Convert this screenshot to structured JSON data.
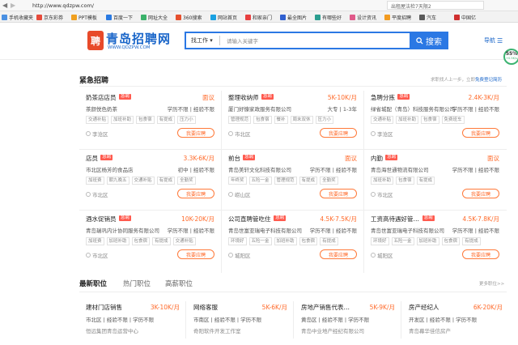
{
  "browser": {
    "url": "http://www.qdzpw.com/",
    "right_search": "出租屋法检7天限2",
    "bookmarks": [
      "手机收藏夹",
      "京东彩券",
      "PPT模板",
      "百度一下",
      "网址大全",
      "360搜索",
      "网站首页",
      "和家亲门",
      "最全图片",
      "有哪些好",
      "设计资讯",
      "平度招聘",
      "汽车",
      "中国亿"
    ]
  },
  "header": {
    "logo_char": "聘",
    "logo_text": "青岛招聘网",
    "logo_url": "WWW.QDZPW.COM",
    "search_type": "找工作",
    "search_placeholder": "请输入关键字",
    "search_button": "搜索",
    "nav": "导航",
    "float_badge": "55%",
    "float_sub": "+0.5K/s"
  },
  "urgent": {
    "title": "紧急招聘",
    "notice": "求职找人上一步，立即",
    "notice_link": "免费登记简历",
    "jobs": [
      {
        "title": "奶茶店店员",
        "badge": "急聘",
        "salary": "面议",
        "company": "茶颜悦色奶茶",
        "req": "学历不限 | 经验不限",
        "tags": [
          "交通补贴",
          "加班补助",
          "包食宿",
          "有提成",
          "压力小"
        ],
        "loc": "李沧区",
        "apply": "我要应聘"
      },
      {
        "title": "整理收纳师",
        "badge": "急聘",
        "salary": "5K-10K/月",
        "company": "厦门好慷家政服务有限公司",
        "req": "大专 | 1-3年",
        "tags": [
          "管理规范",
          "包食宿",
          "餐补",
          "周末双休",
          "压力小"
        ],
        "loc": "市北区",
        "apply": "我要应聘"
      },
      {
        "title": "急聘分拣",
        "badge": "急聘",
        "salary": "2.4K-3K/月",
        "company": "绿省城配（青岛）科技服务有限公司",
        "req": "学历不限 | 经验不限",
        "tags": [
          "交通补贴",
          "加班补助",
          "包食宿",
          "免费班车"
        ],
        "loc": "李沧区",
        "apply": "我要应聘"
      },
      {
        "title": "店员",
        "badge": "急聘",
        "salary": "3.3K-6K/月",
        "company": "市北区杨芳的食品店",
        "req": "初中 | 经验不限",
        "tags": [
          "加班费",
          "朝九晚五",
          "交通补贴",
          "有提成",
          "全勤奖"
        ],
        "loc": "市北区",
        "apply": "我要应聘"
      },
      {
        "title": "前台",
        "badge": "急聘",
        "salary": "面议",
        "company": "青岛美轩文化科技有限公司",
        "req": "学历不限 | 经验不限",
        "tags": [
          "年终奖",
          "五险一金",
          "管理规范",
          "有提成",
          "全勤奖"
        ],
        "loc": "崂山区",
        "apply": "我要应聘"
      },
      {
        "title": "内勤",
        "badge": "急聘",
        "salary": "面议",
        "company": "青岛海世通物流有限公司",
        "req": "学历不限 | 经验不限",
        "tags": [
          "加班补助",
          "包食宿",
          "有提成"
        ],
        "loc": "市北区",
        "apply": "我要应聘"
      },
      {
        "title": "酒水促销员",
        "badge": "急聘",
        "salary": "10K-20K/月",
        "company": "青岛瑞巩内计协同服务有限公司",
        "req": "学历不限 | 经验不限",
        "tags": [
          "加班费",
          "加班补助",
          "包食宿",
          "有提成",
          "交通补贴"
        ],
        "loc": "市北区",
        "apply": "我要应聘"
      },
      {
        "title": "公司直聘管吃住",
        "badge": "急聘",
        "salary": "4.5K-7.5K/月",
        "company": "青岛世富亚瑞电子科技有限公司",
        "req": "学历不限 | 经验不限",
        "tags": [
          "环境好",
          "五险一金",
          "加班补助",
          "包食宿",
          "有提成"
        ],
        "loc": "城阳区",
        "apply": "我要应聘"
      },
      {
        "title": "工资高待遇好管…",
        "badge": "急聘",
        "salary": "4.5K-7.8K/月",
        "company": "青岛世富亚瑞电子科技有限公司",
        "req": "学历不限 | 经验不限",
        "tags": [
          "环境好",
          "五险一金",
          "加班补助",
          "包食宿",
          "有提成"
        ],
        "loc": "城阳区",
        "apply": "我要应聘"
      }
    ]
  },
  "latest": {
    "tabs": [
      "最新职位",
      "热门职位",
      "高薪职位"
    ],
    "more": "更多职位>>",
    "jobs": [
      {
        "title": "建材门店销售",
        "salary": "3K-10K/月",
        "req": "市北区 | 经验不限 | 学历不限",
        "company": "恒远集团青岛运营中心"
      },
      {
        "title": "网络客服",
        "salary": "5K-6K/月",
        "req": "市南区 | 经验不限 | 学历不限",
        "company": "奇阳软件开发工作室"
      },
      {
        "title": "房地产销售代表…",
        "salary": "5K-9K/月",
        "req": "黄岛区 | 经验不限 | 学历不限",
        "company": "青岛中业地产经纪有限公司"
      },
      {
        "title": "房产经纪人",
        "salary": "6K-20K/月",
        "req": "开发区 | 经验不限 | 学历不限",
        "company": "青岛幕华佳信房产"
      }
    ]
  }
}
